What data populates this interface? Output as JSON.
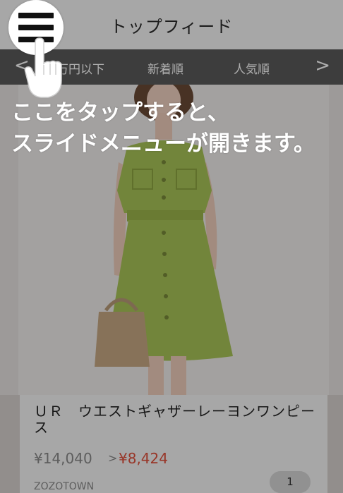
{
  "header": {
    "title": "トップフィード"
  },
  "tabs": {
    "prev_icon": "chevron-left",
    "items": [
      {
        "label": "万円以下"
      },
      {
        "label": "新着順"
      },
      {
        "label": "人気順"
      }
    ],
    "next_icon": "chevron-right"
  },
  "product": {
    "title": "ＵＲ　ウエストギャザーレーヨンワンピース",
    "original_price": "¥14,040",
    "price_separator": ">",
    "sale_price": "¥8,424",
    "brand": "ZOZOTOWN",
    "count": "1"
  },
  "overlay": {
    "line1": "ここをタップすると、",
    "line2": "スライドメニューが開きます。"
  },
  "colors": {
    "tabbar": "#5a5a5a",
    "sale_price": "#e0503c",
    "dress": "#a9c458",
    "overlay_text": "#ffffff"
  }
}
